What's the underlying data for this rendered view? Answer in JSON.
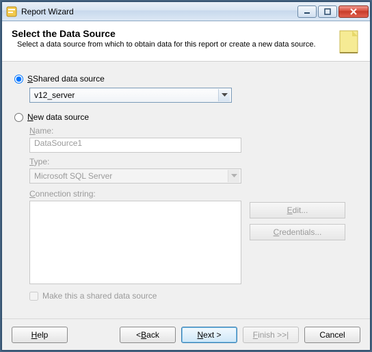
{
  "window": {
    "title": "Report Wizard"
  },
  "header": {
    "title": "Select the Data Source",
    "subtitle": "Select a data source from which to obtain data for this report or create a new data source."
  },
  "dataSource": {
    "sharedLabel": "Shared data source",
    "sharedLetter": "S",
    "sharedValue": "v12_server",
    "newLabel": "ew data source",
    "newLetter": "N",
    "nameLabel": "ame:",
    "nameLetter": "N",
    "nameValue": "DataSource1",
    "typeLabel": "ype:",
    "typeLetter": "T",
    "typeValue": "Microsoft SQL Server",
    "connLabel": "onnection string:",
    "connLetter": "C",
    "editLabel": "dit...",
    "editLetter": "E",
    "credLabel": "redentials...",
    "credLetter": "C",
    "makeSharedLabel": "ake this a shared data source",
    "makeSharedLetter": "M"
  },
  "buttons": {
    "help": "elp",
    "helpLetter": "H",
    "back": "ack",
    "backLetter": "B",
    "backPrefix": "< ",
    "next": "ext >",
    "nextLetter": "N",
    "finish": "inish >>|",
    "finishLetter": "F",
    "cancel": "Cancel"
  }
}
